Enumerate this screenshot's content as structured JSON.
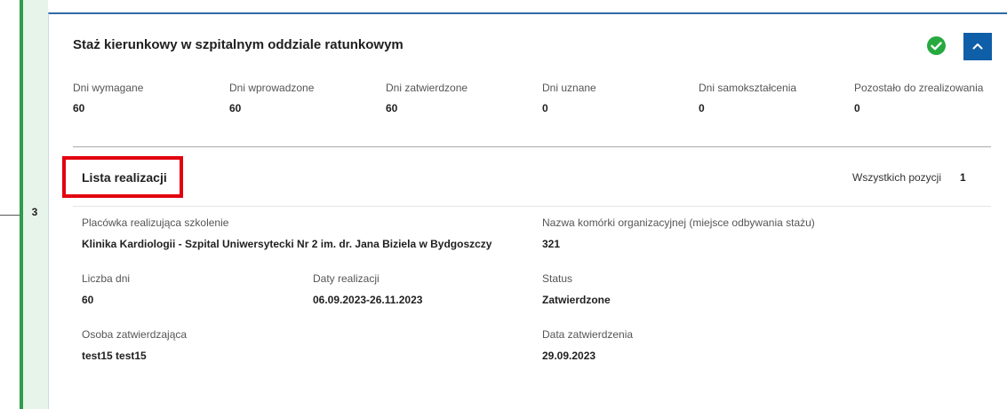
{
  "colors": {
    "rail": "#2e9c48",
    "accent": "#0f5ea8",
    "success": "#27a93f",
    "highlight": "#e2000f"
  },
  "step_number": "3",
  "card": {
    "title": "Staż kierunkowy w szpitalnym oddziale ratunkowym",
    "status_icon": "check-circle-icon",
    "collapse_icon": "chevron-up-icon",
    "stats": [
      {
        "label": "Dni wymagane",
        "value": "60"
      },
      {
        "label": "Dni wprowadzone",
        "value": "60"
      },
      {
        "label": "Dni zatwierdzone",
        "value": "60"
      },
      {
        "label": "Dni uznane",
        "value": "0"
      },
      {
        "label": "Dni samokształcenia",
        "value": "0"
      },
      {
        "label": "Pozostało do zrealizowania",
        "value": "0"
      }
    ]
  },
  "list": {
    "title": "Lista realizacji",
    "count_label": "Wszystkich pozycji",
    "count_value": "1"
  },
  "entry": {
    "placowka_label": "Placówka realizująca szkolenie",
    "placowka_value": "Klinika Kardiologii - Szpital Uniwersytecki Nr 2 im. dr. Jana Biziela w Bydgoszczy",
    "komorka_label": "Nazwa komórki organizacyjnej (miejsce odbywania stażu)",
    "komorka_value": "321",
    "dni_label": "Liczba dni",
    "dni_value": "60",
    "daty_label": "Daty realizacji",
    "daty_value": "06.09.2023-26.11.2023",
    "status_label": "Status",
    "status_value": "Zatwierdzone",
    "osoba_label": "Osoba zatwierdzająca",
    "osoba_value": "test15 test15",
    "data_label": "Data zatwierdzenia",
    "data_value": "29.09.2023"
  }
}
